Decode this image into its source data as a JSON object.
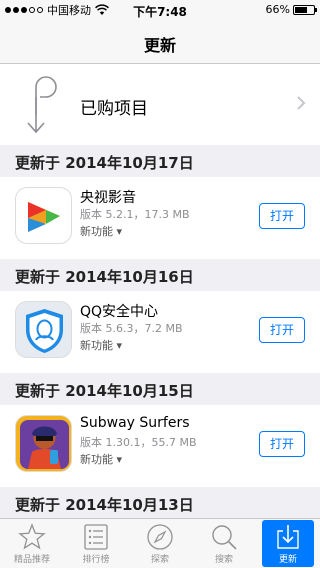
{
  "status_bar": {
    "carrier": "中国移动",
    "time": "下午7:48",
    "battery": "66%",
    "battery_level": 0.66
  },
  "nav": {
    "title": "更新"
  },
  "purchased": {
    "label": "已购项目"
  },
  "sections": [
    {
      "header": "更新于 2014年10月17日",
      "app": {
        "name": "央视影音",
        "version": "版本 5.2.1，17.3 MB",
        "whatsnew": "新功能 ▾",
        "button": "打开",
        "icon": "cctv-icon"
      }
    },
    {
      "header": "更新于 2014年10月16日",
      "app": {
        "name": "QQ安全中心",
        "version": "版本 5.6.3，7.2 MB",
        "whatsnew": "新功能 ▾",
        "button": "打开",
        "icon": "qq-security-icon"
      }
    },
    {
      "header": "更新于 2014年10月15日",
      "app": {
        "name": "Subway Surfers",
        "version": "版本 1.30.1，55.7 MB",
        "whatsnew": "新功能 ▾",
        "button": "打开",
        "icon": "subway-surfers-icon"
      }
    },
    {
      "header": "更新于 2014年10月13日"
    }
  ],
  "tabs": [
    {
      "label": "精品推荐",
      "icon": "star-icon"
    },
    {
      "label": "排行榜",
      "icon": "list-icon"
    },
    {
      "label": "探索",
      "icon": "compass-icon"
    },
    {
      "label": "搜索",
      "icon": "search-icon"
    },
    {
      "label": "更新",
      "icon": "updates-icon",
      "active": true
    }
  ],
  "colors": {
    "accent": "#007aff",
    "section_bg": "#efeff4",
    "bar_bg": "#f7f7f7"
  }
}
